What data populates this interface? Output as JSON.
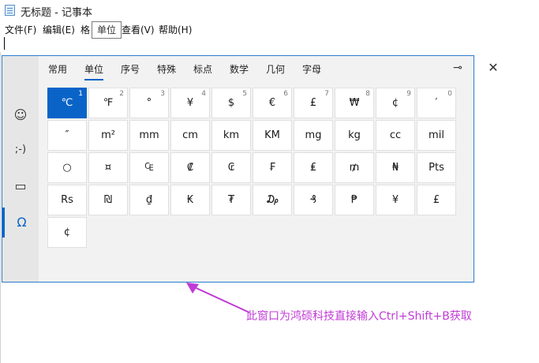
{
  "window": {
    "title": "无标题 - 记事本"
  },
  "menu": [
    "文件(F)",
    "编辑(E)",
    "格",
    "查看(V)",
    "帮助(H)"
  ],
  "tooltip": "单位",
  "sidebar": [
    {
      "icon": "smiley-icon",
      "glyph": "☺"
    },
    {
      "icon": "kaomoji-icon",
      "glyph": ";-)"
    },
    {
      "icon": "image-icon",
      "glyph": "▭"
    },
    {
      "icon": "omega-icon",
      "glyph": "Ω"
    }
  ],
  "tabs": [
    "常用",
    "单位",
    "序号",
    "特殊",
    "标点",
    "数学",
    "几何",
    "字母"
  ],
  "active_tab": "单位",
  "pin_glyph": "⊸",
  "close_glyph": "✕",
  "symbols": [
    [
      "℃",
      "1"
    ],
    [
      "℉",
      "2"
    ],
    [
      "°",
      "3"
    ],
    [
      "¥",
      "4"
    ],
    [
      "$",
      "5"
    ],
    [
      "€",
      "6"
    ],
    [
      "£",
      "7"
    ],
    [
      "₩",
      "8"
    ],
    [
      "¢",
      "9"
    ],
    [
      "′",
      "0"
    ],
    [
      "″",
      ""
    ],
    [
      "m²",
      ""
    ],
    [
      "mm",
      ""
    ],
    [
      "cm",
      ""
    ],
    [
      "km",
      ""
    ],
    [
      "KM",
      ""
    ],
    [
      "mg",
      ""
    ],
    [
      "kg",
      ""
    ],
    [
      "cc",
      ""
    ],
    [
      "mil",
      ""
    ],
    [
      "○",
      ""
    ],
    [
      "¤",
      ""
    ],
    [
      "₠",
      ""
    ],
    [
      "₡",
      ""
    ],
    [
      "₢",
      ""
    ],
    [
      "₣",
      ""
    ],
    [
      "₤",
      ""
    ],
    [
      "₥",
      ""
    ],
    [
      "₦",
      ""
    ],
    [
      "Pts",
      ""
    ],
    [
      "Rs",
      ""
    ],
    [
      "₪",
      ""
    ],
    [
      "₫",
      ""
    ],
    [
      "₭",
      ""
    ],
    [
      "₮",
      ""
    ],
    [
      "₯",
      ""
    ],
    [
      "₰",
      ""
    ],
    [
      "₱",
      ""
    ],
    [
      "¥",
      ""
    ],
    [
      "£",
      ""
    ],
    [
      "¢",
      ""
    ]
  ],
  "selected_symbol_index": 0,
  "annotation": "此窗口为鸿硕科技直接输入Ctrl+Shift+B获取",
  "colors": {
    "accent": "#0a64c8",
    "annotation": "#c13bd6"
  }
}
